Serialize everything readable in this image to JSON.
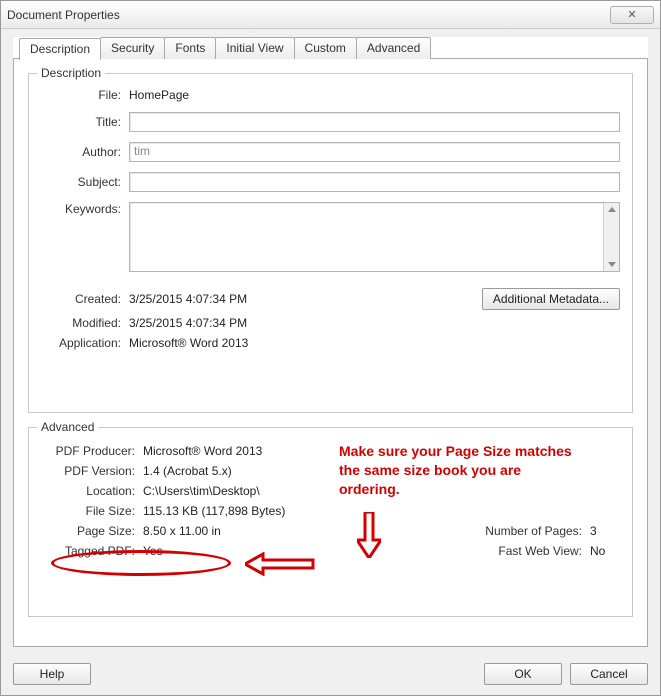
{
  "window": {
    "title": "Document Properties"
  },
  "tabs": [
    "Description",
    "Security",
    "Fonts",
    "Initial View",
    "Custom",
    "Advanced"
  ],
  "description": {
    "legend": "Description",
    "file_label": "File:",
    "file_value": "HomePage",
    "title_label": "Title:",
    "title_value": "",
    "author_label": "Author:",
    "author_value": "tim",
    "subject_label": "Subject:",
    "subject_value": "",
    "keywords_label": "Keywords:",
    "keywords_value": "",
    "created_label": "Created:",
    "created_value": "3/25/2015 4:07:34 PM",
    "modified_label": "Modified:",
    "modified_value": "3/25/2015 4:07:34 PM",
    "application_label": "Application:",
    "application_value": "Microsoft® Word 2013",
    "additional_metadata_btn": "Additional Metadata..."
  },
  "advanced": {
    "legend": "Advanced",
    "pdf_producer_label": "PDF Producer:",
    "pdf_producer_value": "Microsoft® Word 2013",
    "pdf_version_label": "PDF Version:",
    "pdf_version_value": "1.4 (Acrobat 5.x)",
    "location_label": "Location:",
    "location_value": "C:\\Users\\tim\\Desktop\\",
    "file_size_label": "File Size:",
    "file_size_value": "115.13 KB (117,898 Bytes)",
    "page_size_label": "Page Size:",
    "page_size_value": "8.50 x 11.00 in",
    "number_pages_label": "Number of Pages:",
    "number_pages_value": "3",
    "tagged_pdf_label": "Tagged PDF:",
    "tagged_pdf_value": "Yes",
    "fast_web_label": "Fast Web View:",
    "fast_web_value": "No"
  },
  "buttons": {
    "help": "Help",
    "ok": "OK",
    "cancel": "Cancel"
  },
  "annotation": {
    "line1": "Make sure your Page Size matches",
    "line2": "the same size book you are",
    "line3": "ordering."
  }
}
